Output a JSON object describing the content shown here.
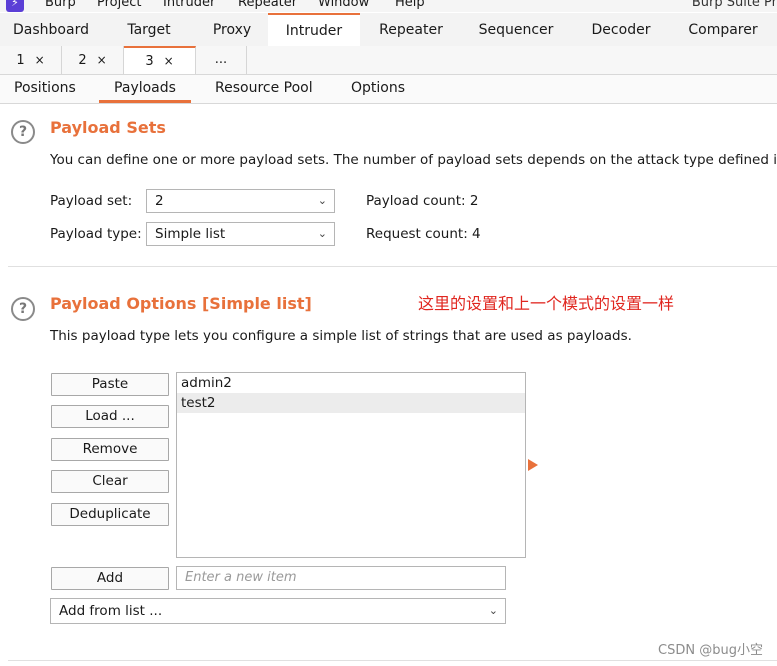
{
  "menu": {
    "items": [
      "Burp",
      "Project",
      "Intruder",
      "Repeater",
      "Window",
      "Help"
    ],
    "app_title": "Burp Suite Pr"
  },
  "main_tabs": [
    "Dashboard",
    "Target",
    "Proxy",
    "Intruder",
    "Repeater",
    "Sequencer",
    "Decoder",
    "Comparer"
  ],
  "attack_tabs": [
    {
      "label": "1",
      "close": "×"
    },
    {
      "label": "2",
      "close": "×"
    },
    {
      "label": "3",
      "close": "×"
    },
    {
      "label": "...",
      "close": ""
    }
  ],
  "section_tabs": [
    "Positions",
    "Payloads",
    "Resource Pool",
    "Options"
  ],
  "payload_sets": {
    "title": "Payload Sets",
    "description": "You can define one or more payload sets. The number of payload sets depends on the attack type defined in",
    "payload_set_label": "Payload set:",
    "payload_set_value": "2",
    "payload_type_label": "Payload type:",
    "payload_type_value": "Simple list",
    "payload_count": "Payload count: 2",
    "request_count": "Request count: 4"
  },
  "payload_options": {
    "title": "Payload Options [Simple list]",
    "annotation": "这里的设置和上一个模式的设置一样",
    "description": "This payload type lets you configure a simple list of strings that are used as payloads.",
    "buttons": {
      "paste": "Paste",
      "load": "Load ...",
      "remove": "Remove",
      "clear": "Clear",
      "deduplicate": "Deduplicate",
      "add": "Add"
    },
    "list_items": [
      "admin2",
      "test2"
    ],
    "new_item_placeholder": "Enter a new item",
    "add_from_list": "Add from list ..."
  },
  "watermark": "CSDN @bug小空",
  "colors": {
    "accent": "#e8713b",
    "annotation": "#e0261f",
    "logo": "#5b3fd6"
  }
}
